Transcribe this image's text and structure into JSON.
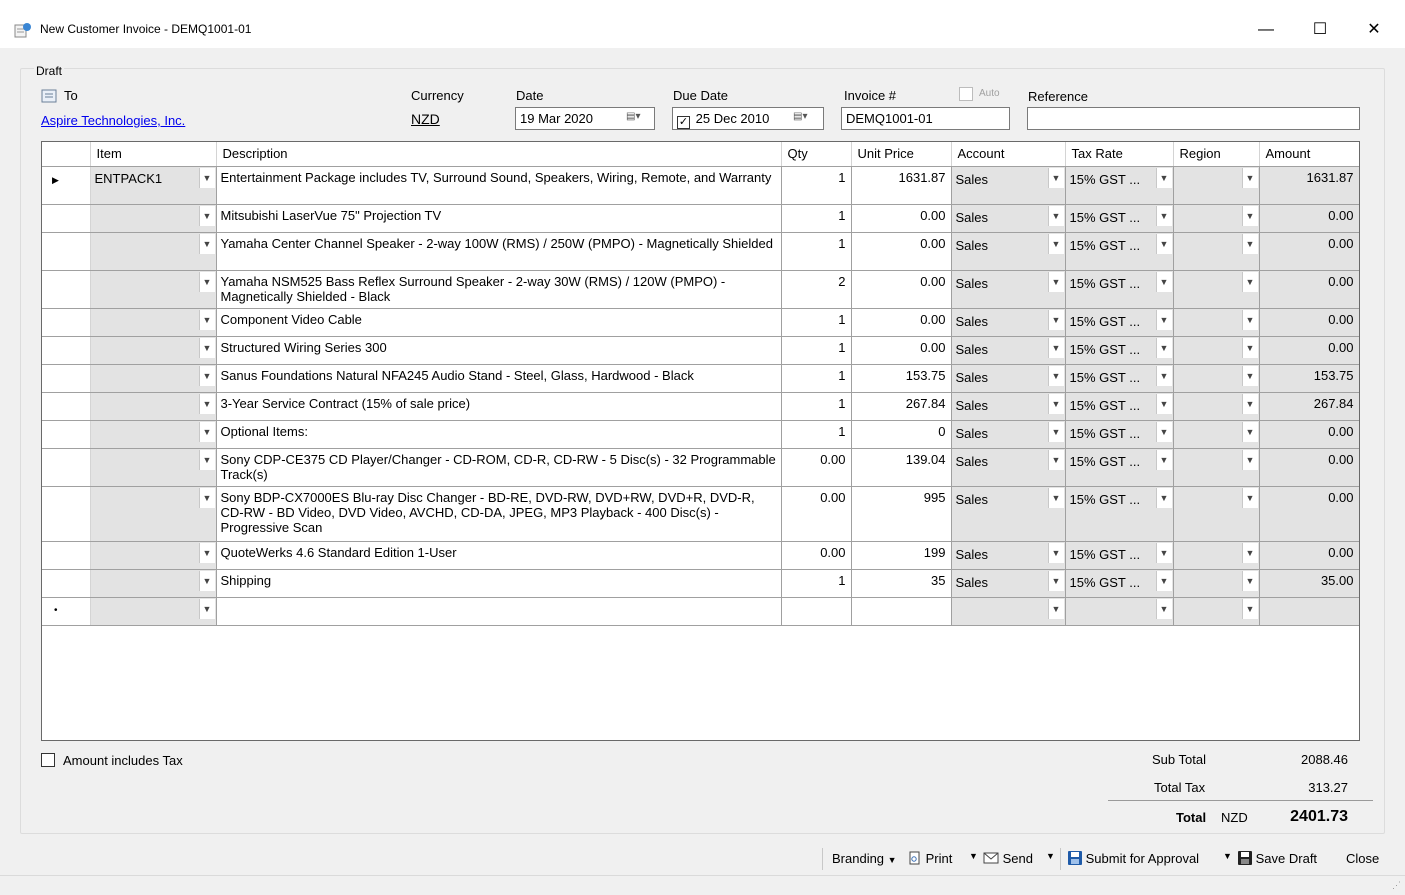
{
  "window": {
    "title": "New Customer Invoice - DEMQ1001-01",
    "minimize": "—",
    "maximize": "☐",
    "close": "✕"
  },
  "draft_label": "Draft",
  "to": {
    "label": "To",
    "customer": "Aspire Technologies, Inc."
  },
  "currency": {
    "label": "Currency",
    "value": "NZD"
  },
  "date": {
    "label": "Date",
    "value": "19 Mar 2020"
  },
  "due_date": {
    "label": "Due Date",
    "value": "25 Dec 2010",
    "checked": true
  },
  "invoice": {
    "label": "Invoice #",
    "value": "DEMQ1001-01",
    "auto_label": "Auto"
  },
  "reference": {
    "label": "Reference",
    "value": ""
  },
  "grid": {
    "headers": [
      "Item",
      "Description",
      "Qty",
      "Unit Price",
      "Account",
      "Tax Rate",
      "Region",
      "Amount"
    ],
    "rows": [
      {
        "item": "ENTPACK1",
        "description": "Entertainment Package includes TV, Surround Sound, Speakers, Wiring, Remote, and Warranty",
        "qty": "1",
        "unit_price": "1631.87",
        "account": "Sales",
        "tax_rate": "15% GST ...",
        "region": "",
        "amount": "1631.87"
      },
      {
        "item": "",
        "description": "Mitsubishi LaserVue 75\" Projection TV",
        "qty": "1",
        "unit_price": "0.00",
        "account": "Sales",
        "tax_rate": "15% GST ...",
        "region": "",
        "amount": "0.00"
      },
      {
        "item": "",
        "description": "Yamaha Center Channel Speaker - 2-way 100W (RMS) / 250W (PMPO) - Magnetically Shielded",
        "qty": "1",
        "unit_price": "0.00",
        "account": "Sales",
        "tax_rate": "15% GST ...",
        "region": "",
        "amount": "0.00"
      },
      {
        "item": "",
        "description": "Yamaha NSM525 Bass Reflex Surround Speaker - 2-way 30W (RMS) / 120W (PMPO) - Magnetically Shielded - Black",
        "qty": "2",
        "unit_price": "0.00",
        "account": "Sales",
        "tax_rate": "15% GST ...",
        "region": "",
        "amount": "0.00"
      },
      {
        "item": "",
        "description": "Component Video Cable",
        "qty": "1",
        "unit_price": "0.00",
        "account": "Sales",
        "tax_rate": "15% GST ...",
        "region": "",
        "amount": "0.00"
      },
      {
        "item": "",
        "description": "Structured Wiring Series 300",
        "qty": "1",
        "unit_price": "0.00",
        "account": "Sales",
        "tax_rate": "15% GST ...",
        "region": "",
        "amount": "0.00"
      },
      {
        "item": "",
        "description": "Sanus Foundations Natural NFA245 Audio Stand - Steel, Glass, Hardwood - Black",
        "qty": "1",
        "unit_price": "153.75",
        "account": "Sales",
        "tax_rate": "15% GST ...",
        "region": "",
        "amount": "153.75"
      },
      {
        "item": "",
        "description": "3-Year Service Contract (15% of sale price)",
        "qty": "1",
        "unit_price": "267.84",
        "account": "Sales",
        "tax_rate": "15% GST ...",
        "region": "",
        "amount": "267.84"
      },
      {
        "item": "",
        "description": "Optional Items:",
        "qty": "1",
        "unit_price": "0",
        "account": "Sales",
        "tax_rate": "15% GST ...",
        "region": "",
        "amount": "0.00"
      },
      {
        "item": "",
        "description": "Sony CDP-CE375 CD Player/Changer - CD-ROM, CD-R, CD-RW - 5 Disc(s) - 32 Programmable Track(s)",
        "qty": "0.00",
        "unit_price": "139.04",
        "account": "Sales",
        "tax_rate": "15% GST ...",
        "region": "",
        "amount": "0.00"
      },
      {
        "item": "",
        "description": "Sony BDP-CX7000ES Blu-ray Disc Changer - BD-RE, DVD-RW, DVD+RW, DVD+R, DVD-R, CD-RW - BD Video, DVD Video, AVCHD, CD-DA, JPEG, MP3 Playback - 400 Disc(s) - Progressive Scan",
        "qty": "0.00",
        "unit_price": "995",
        "account": "Sales",
        "tax_rate": "15% GST ...",
        "region": "",
        "amount": "0.00"
      },
      {
        "item": "",
        "description": "QuoteWerks 4.6 Standard Edition 1-User",
        "qty": "0.00",
        "unit_price": "199",
        "account": "Sales",
        "tax_rate": "15% GST ...",
        "region": "",
        "amount": "0.00"
      },
      {
        "item": "",
        "description": "Shipping",
        "qty": "1",
        "unit_price": "35",
        "account": "Sales",
        "tax_rate": "15% GST ...",
        "region": "",
        "amount": "35.00"
      }
    ]
  },
  "amount_includes_tax": {
    "label": "Amount includes Tax",
    "checked": false
  },
  "totals": {
    "sub_total_label": "Sub Total",
    "sub_total": "2088.46",
    "total_tax_label": "Total Tax",
    "total_tax": "313.27",
    "total_label": "Total",
    "currency": "NZD",
    "total": "2401.73"
  },
  "toolbar": {
    "branding": "Branding",
    "print": "Print",
    "send": "Send",
    "submit": "Submit for Approval",
    "save_draft": "Save Draft",
    "close": "Close"
  },
  "colors": {
    "link": "#0000ee",
    "combo_bg": "#e3e3e3",
    "save_icon": "#1e5aa8"
  }
}
